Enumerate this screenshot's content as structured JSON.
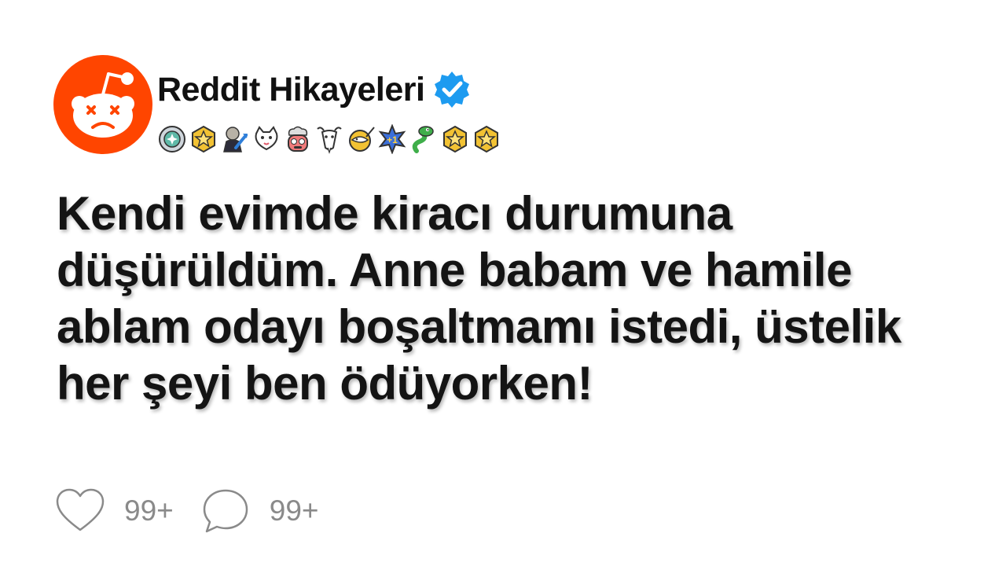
{
  "author": {
    "name": "Reddit Hikayeleri",
    "verified": true,
    "avatar_icon": "reddit-snoo-icon",
    "avatar_color": "#ff4500"
  },
  "badges": [
    "medal-badge-icon",
    "gold-star-badge-icon",
    "stonks-badge-icon",
    "cat-badge-icon",
    "mind-blown-badge-icon",
    "goat-badge-icon",
    "narwhal-badge-icon",
    "plus-one-badge-icon",
    "snake-badge-icon",
    "gold-star-badge-icon",
    "gold-star-badge-icon"
  ],
  "post": {
    "title": "Kendi evimde kiracı durumuna düşürüldüm. Anne babam ve hamile ablam odayı boşaltmamı istedi, üstelik her şeyi ben ödüyorken!"
  },
  "actions": {
    "likes": {
      "icon": "heart-icon",
      "count": "99+"
    },
    "comments": {
      "icon": "comment-bubble-icon",
      "count": "99+"
    }
  },
  "colors": {
    "accent": "#ff4500",
    "verified": "#1d9bf0",
    "muted": "#8a8a8a"
  }
}
